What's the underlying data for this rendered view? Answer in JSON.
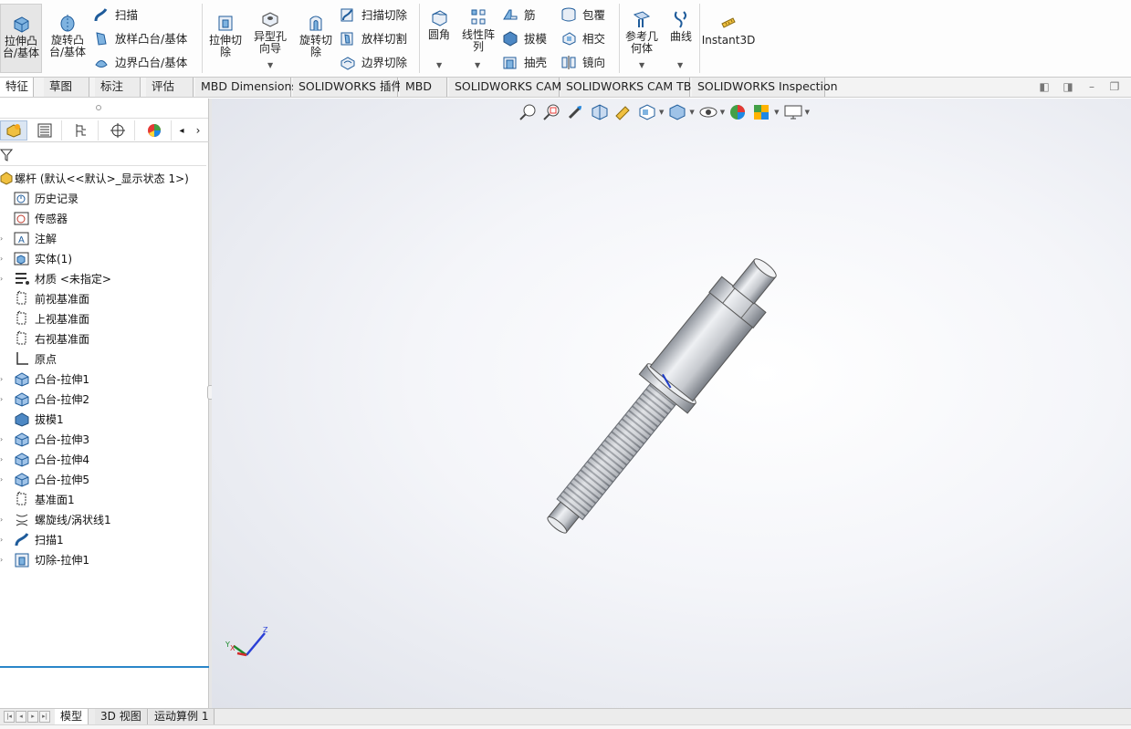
{
  "ribbon": {
    "extrude_boss": "拉伸凸台/基体",
    "revolve_boss": "旋转凸台/基体",
    "sweep": "扫描",
    "loft_boss": "放样凸台/基体",
    "boundary_boss": "边界凸台/基体",
    "extrude_cut": "拉伸切除",
    "hole_wizard": "异型孔向导",
    "revolve_cut": "旋转切除",
    "swept_cut": "扫描切除",
    "lofted_cut": "放样切割",
    "boundary_cut": "边界切除",
    "fillet": "圆角",
    "linear_pattern": "线性阵列",
    "rib": "筋",
    "draft": "拔模",
    "shell": "抽壳",
    "wrap": "包覆",
    "intersect": "相交",
    "mirror": "镜向",
    "ref_geometry": "参考几何体",
    "curves": "曲线",
    "instant3d": "Instant3D"
  },
  "tabs": [
    "特征",
    "草图",
    "标注",
    "评估",
    "MBD Dimensions",
    "SOLIDWORKS 插件",
    "MBD",
    "SOLIDWORKS CAM",
    "SOLIDWORKS CAM TBM",
    "SOLIDWORKS Inspection"
  ],
  "tree": {
    "root": "螺杆 (默认<<默认>_显示状态 1>)",
    "items": [
      {
        "label": "历史记录",
        "icon": "history-icon"
      },
      {
        "label": "传感器",
        "icon": "sensor-icon"
      },
      {
        "label": "注解",
        "icon": "annotation-icon"
      },
      {
        "label": "实体(1)",
        "icon": "solid-bodies-icon"
      },
      {
        "label": "材质 <未指定>",
        "icon": "material-icon"
      },
      {
        "label": "前视基准面",
        "icon": "plane-icon"
      },
      {
        "label": "上视基准面",
        "icon": "plane-icon"
      },
      {
        "label": "右视基准面",
        "icon": "plane-icon"
      },
      {
        "label": "原点",
        "icon": "origin-icon"
      },
      {
        "label": "凸台-拉伸1",
        "icon": "extrude-feature-icon"
      },
      {
        "label": "凸台-拉伸2",
        "icon": "extrude-feature-icon"
      },
      {
        "label": "拔模1",
        "icon": "draft-feature-icon"
      },
      {
        "label": "凸台-拉伸3",
        "icon": "extrude-feature-icon"
      },
      {
        "label": "凸台-拉伸4",
        "icon": "extrude-feature-icon"
      },
      {
        "label": "凸台-拉伸5",
        "icon": "extrude-feature-icon"
      },
      {
        "label": "基准面1",
        "icon": "plane-icon"
      },
      {
        "label": "螺旋线/涡状线1",
        "icon": "helix-icon"
      },
      {
        "label": "扫描1",
        "icon": "sweep-feature-icon"
      },
      {
        "label": "切除-拉伸1",
        "icon": "cut-extrude-feature-icon"
      }
    ]
  },
  "bottom_tabs": [
    "模型",
    "3D 视图",
    "运动算例 1"
  ],
  "triad": {
    "x": "X",
    "y": "Y",
    "z": "Z"
  },
  "colors": {
    "accent": "#2a86c9",
    "model": "#c9ccd1"
  }
}
